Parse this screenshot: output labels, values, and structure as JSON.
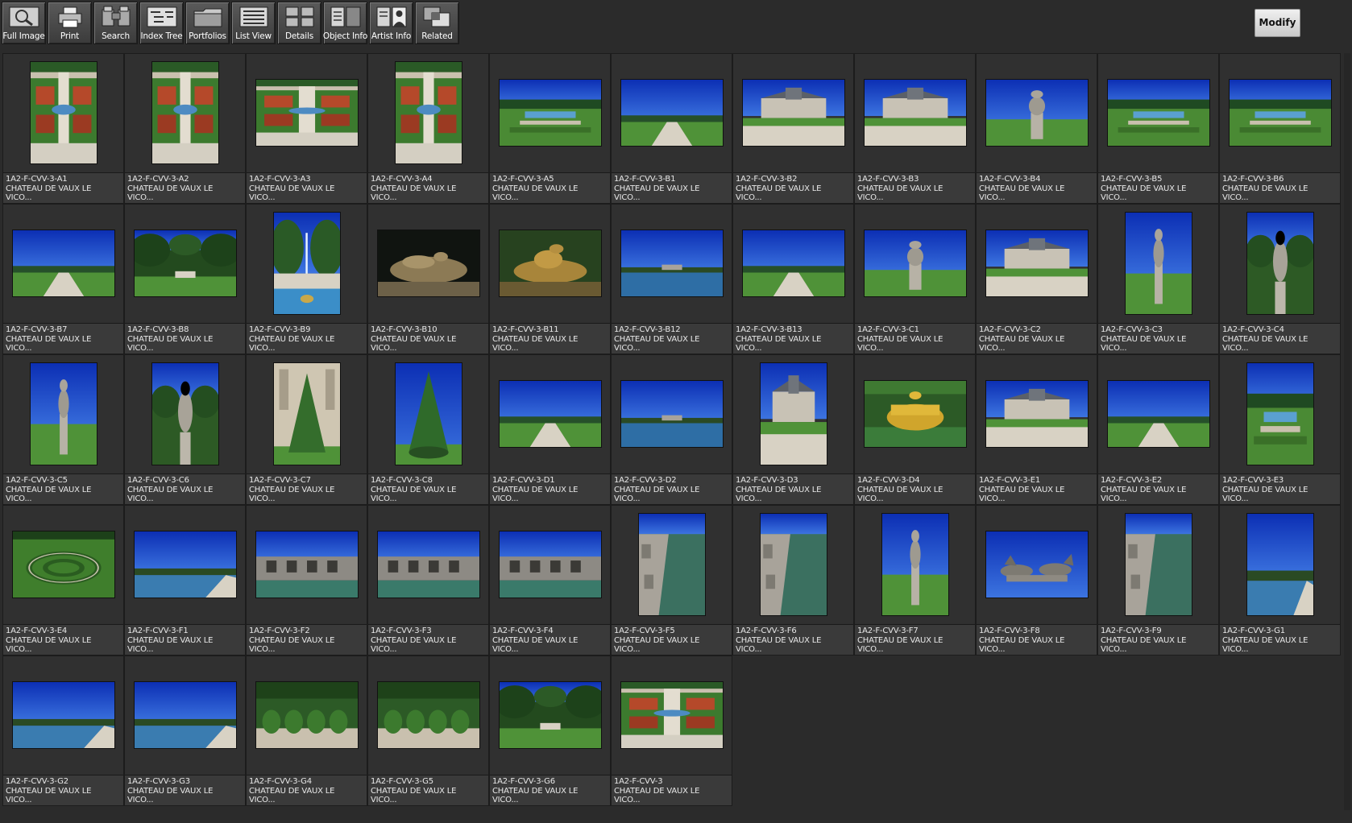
{
  "toolbar": [
    {
      "label": "Full Image",
      "icon": "magnifier-icon",
      "name": "full-image-button"
    },
    {
      "label": "Print",
      "icon": "printer-icon",
      "name": "print-button"
    },
    {
      "label": "Search",
      "icon": "binoculars-icon",
      "name": "search-button"
    },
    {
      "label": "Index Tree",
      "icon": "index-tree-icon",
      "name": "index-tree-button"
    },
    {
      "label": "Portfolios",
      "icon": "folder-icon",
      "name": "portfolios-button"
    },
    {
      "label": "List View",
      "icon": "list-view-icon",
      "name": "list-view-button"
    },
    {
      "label": "Details",
      "icon": "details-grid-icon",
      "name": "details-button"
    },
    {
      "label": "Object Info",
      "icon": "object-info-icon",
      "name": "object-info-button"
    },
    {
      "label": "Artist  Info",
      "icon": "artist-portrait-icon",
      "name": "artist-info-button"
    },
    {
      "label": "Related",
      "icon": "related-images-icon",
      "name": "related-button"
    }
  ],
  "modify_button": {
    "label": "Modify"
  },
  "caption_title": "CHATEAU DE VAUX LE\nVICO...",
  "thumbnails": [
    {
      "id": "1A2-F-CVV-3-A1",
      "orient": "portrait",
      "scene": "garden-aerial"
    },
    {
      "id": "1A2-F-CVV-3-A2",
      "orient": "portrait",
      "scene": "garden-aerial"
    },
    {
      "id": "1A2-F-CVV-3-A3",
      "orient": "landscape",
      "scene": "garden-aerial"
    },
    {
      "id": "1A2-F-CVV-3-A4",
      "orient": "portrait",
      "scene": "garden-aerial"
    },
    {
      "id": "1A2-F-CVV-3-A5",
      "orient": "landscape",
      "scene": "garden-lawn"
    },
    {
      "id": "1A2-F-CVV-3-B1",
      "orient": "landscape",
      "scene": "sky-lawn"
    },
    {
      "id": "1A2-F-CVV-3-B2",
      "orient": "landscape",
      "scene": "chateau"
    },
    {
      "id": "1A2-F-CVV-3-B3",
      "orient": "landscape",
      "scene": "chateau"
    },
    {
      "id": "1A2-F-CVV-3-B4",
      "orient": "landscape",
      "scene": "statue-sky"
    },
    {
      "id": "1A2-F-CVV-3-B5",
      "orient": "landscape",
      "scene": "garden-lawn"
    },
    {
      "id": "1A2-F-CVV-3-B6",
      "orient": "landscape",
      "scene": "garden-lawn"
    },
    {
      "id": "1A2-F-CVV-3-B7",
      "orient": "landscape",
      "scene": "sky-lawn"
    },
    {
      "id": "1A2-F-CVV-3-B8",
      "orient": "landscape",
      "scene": "trees"
    },
    {
      "id": "1A2-F-CVV-3-B9",
      "orient": "portrait",
      "scene": "fountain"
    },
    {
      "id": "1A2-F-CVV-3-B10",
      "orient": "landscape",
      "scene": "sculpture-dark"
    },
    {
      "id": "1A2-F-CVV-3-B11",
      "orient": "landscape",
      "scene": "sculpture-gold"
    },
    {
      "id": "1A2-F-CVV-3-B12",
      "orient": "landscape",
      "scene": "water-sky"
    },
    {
      "id": "1A2-F-CVV-3-B13",
      "orient": "landscape",
      "scene": "sky-lawn"
    },
    {
      "id": "1A2-F-CVV-3-C1",
      "orient": "landscape",
      "scene": "statue-sky"
    },
    {
      "id": "1A2-F-CVV-3-C2",
      "orient": "landscape",
      "scene": "chateau"
    },
    {
      "id": "1A2-F-CVV-3-C3",
      "orient": "portrait",
      "scene": "statue-sky"
    },
    {
      "id": "1A2-F-CVV-3-C4",
      "orient": "portrait",
      "scene": "statue-trees"
    },
    {
      "id": "1A2-F-CVV-3-C5",
      "orient": "portrait",
      "scene": "statue-sky"
    },
    {
      "id": "1A2-F-CVV-3-C6",
      "orient": "portrait",
      "scene": "statue-trees"
    },
    {
      "id": "1A2-F-CVV-3-C7",
      "orient": "portrait",
      "scene": "topiary-building"
    },
    {
      "id": "1A2-F-CVV-3-C8",
      "orient": "portrait",
      "scene": "topiary"
    },
    {
      "id": "1A2-F-CVV-3-D1",
      "orient": "landscape",
      "scene": "sky-lawn"
    },
    {
      "id": "1A2-F-CVV-3-D2",
      "orient": "landscape",
      "scene": "water-sky"
    },
    {
      "id": "1A2-F-CVV-3-D3",
      "orient": "portrait",
      "scene": "chateau"
    },
    {
      "id": "1A2-F-CVV-3-D4",
      "orient": "landscape",
      "scene": "crown"
    },
    {
      "id": "1A2-F-CVV-3-E1",
      "orient": "landscape",
      "scene": "chateau"
    },
    {
      "id": "1A2-F-CVV-3-E2",
      "orient": "landscape",
      "scene": "sky-lawn"
    },
    {
      "id": "1A2-F-CVV-3-E3",
      "orient": "portrait",
      "scene": "garden-lawn"
    },
    {
      "id": "1A2-F-CVV-3-E4",
      "orient": "landscape",
      "scene": "hedge-maze"
    },
    {
      "id": "1A2-F-CVV-3-F1",
      "orient": "landscape",
      "scene": "canal-sky"
    },
    {
      "id": "1A2-F-CVV-3-F2",
      "orient": "landscape",
      "scene": "grottos"
    },
    {
      "id": "1A2-F-CVV-3-F3",
      "orient": "landscape",
      "scene": "grottos"
    },
    {
      "id": "1A2-F-CVV-3-F4",
      "orient": "landscape",
      "scene": "grottos"
    },
    {
      "id": "1A2-F-CVV-3-F5",
      "orient": "portrait",
      "scene": "stone-water"
    },
    {
      "id": "1A2-F-CVV-3-F6",
      "orient": "portrait",
      "scene": "stone-water"
    },
    {
      "id": "1A2-F-CVV-3-F7",
      "orient": "portrait",
      "scene": "statue-sky"
    },
    {
      "id": "1A2-F-CVV-3-F8",
      "orient": "landscape",
      "scene": "horses-sky"
    },
    {
      "id": "1A2-F-CVV-3-F9",
      "orient": "portrait",
      "scene": "stone-water"
    },
    {
      "id": "1A2-F-CVV-3-G1",
      "orient": "portrait",
      "scene": "canal-sky"
    },
    {
      "id": "1A2-F-CVV-3-G2",
      "orient": "landscape",
      "scene": "canal-sky"
    },
    {
      "id": "1A2-F-CVV-3-G3",
      "orient": "landscape",
      "scene": "canal-sky"
    },
    {
      "id": "1A2-F-CVV-3-G4",
      "orient": "landscape",
      "scene": "topiary-rows"
    },
    {
      "id": "1A2-F-CVV-3-G5",
      "orient": "landscape",
      "scene": "topiary-rows"
    },
    {
      "id": "1A2-F-CVV-3-G6",
      "orient": "landscape",
      "scene": "trees"
    },
    {
      "id": "1A2-F-CVV-3",
      "orient": "landscape",
      "scene": "garden-aerial"
    }
  ]
}
